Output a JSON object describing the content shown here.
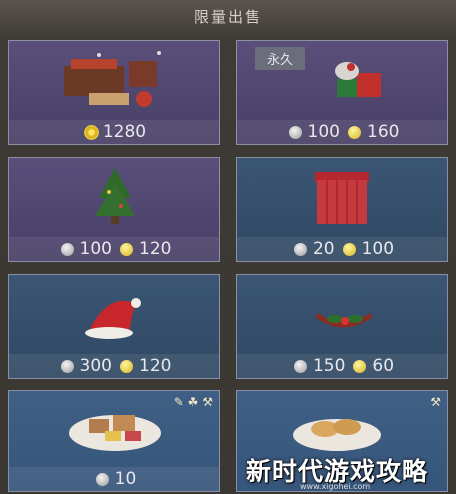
{
  "header": {
    "title": "限量出售"
  },
  "items": [
    {
      "badge": "",
      "prices": [
        {
          "currency": "sun-coin",
          "amount": "1280"
        }
      ]
    },
    {
      "badge": "永久",
      "prices": [
        {
          "currency": "silver-apple",
          "amount": "100"
        },
        {
          "currency": "gold-apple",
          "amount": "160"
        }
      ]
    },
    {
      "badge": "",
      "prices": [
        {
          "currency": "silver-apple",
          "amount": "100"
        },
        {
          "currency": "gold-apple",
          "amount": "120"
        }
      ]
    },
    {
      "badge": "",
      "prices": [
        {
          "currency": "silver-apple",
          "amount": "20"
        },
        {
          "currency": "gold-apple",
          "amount": "100"
        }
      ]
    },
    {
      "badge": "",
      "prices": [
        {
          "currency": "silver-apple",
          "amount": "300"
        },
        {
          "currency": "gold-apple",
          "amount": "120"
        }
      ]
    },
    {
      "badge": "",
      "prices": [
        {
          "currency": "silver-apple",
          "amount": "150"
        },
        {
          "currency": "gold-apple",
          "amount": "60"
        }
      ]
    },
    {
      "badge": "",
      "prices": [
        {
          "currency": "silver-apple",
          "amount": "10"
        }
      ]
    },
    {
      "badge": "",
      "prices": []
    }
  ],
  "watermark": {
    "text": "新时代游戏攻略",
    "url": "www.xigohei.com"
  }
}
